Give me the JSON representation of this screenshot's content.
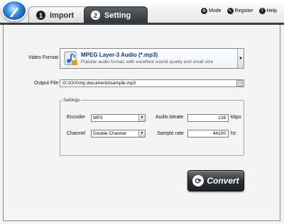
{
  "tabs": [
    {
      "number": "1",
      "label": "Import"
    },
    {
      "number": "2",
      "label": "Setting"
    }
  ],
  "top_links": [
    {
      "icon": "gear-icon",
      "label": "Mode"
    },
    {
      "icon": "register-icon",
      "label": "Register"
    },
    {
      "icon": "help-icon",
      "label": "Help"
    }
  ],
  "video_format": {
    "label": "Video Format",
    "title": "MPEG Layer-3 Audio (*.mp3)",
    "description": "Popular audio format, with excellent sound quality and small size"
  },
  "output_file": {
    "label": "Output File",
    "value": "G:\\XXX\\my documents\\sample.mp3"
  },
  "settings": {
    "legend": "Settings",
    "encoder_label": "Encoder",
    "encoder_value": "MP3",
    "channel_label": "Channel",
    "channel_value": "Double Channel",
    "bitrate_label": "Audio bitrate",
    "bitrate_value": "128",
    "bitrate_unit": "kbps",
    "samplerate_label": "Sample rate",
    "samplerate_value": "44100",
    "samplerate_unit": "hz"
  },
  "convert_label": "Convert",
  "colors": {
    "accent_dark": "#2f3439",
    "format_title": "#15307a"
  }
}
